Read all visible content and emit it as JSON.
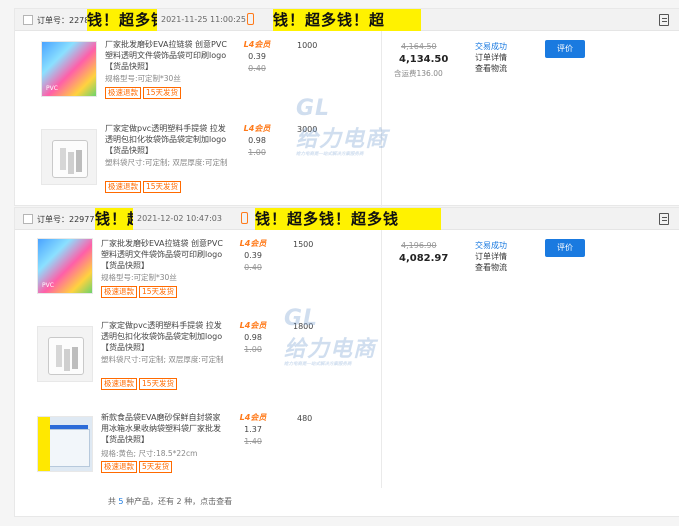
{
  "orders": [
    {
      "order_no": "订单号：2278072",
      "date": "2021-11-25 11:00:25",
      "overlay_text": "钱！超多钱！超",
      "items": [
        {
          "title": "厂家批发磨砂EVA拉链袋 创意PVC塑料透明文件袋饰品袋可印刷logo 【货品快照】",
          "spec": "规格型号:可定制*30丝",
          "tags": [
            "极速退款",
            "15天发货"
          ],
          "level": "L4会员",
          "price": "0.39",
          "orig_price": "0.40",
          "qty": "1000",
          "thumb": "colorful-bags"
        },
        {
          "title": "厂家定做pvc透明塑料手提袋 拉发透明包扣化妆袋饰品袋定制加logo 【货品快照】",
          "spec": "塑料袋尺寸:可定制; 双层厚度:可定制",
          "tags": [
            "极速退款",
            "15天发货"
          ],
          "level": "L4会员",
          "price": "0.98",
          "orig_price": "1.00",
          "qty": "3000",
          "thumb": "clear-bag"
        }
      ],
      "total_orig": "4,164.50",
      "total": "4,134.50",
      "shipping": "含运费136.00",
      "status": [
        "交易成功",
        "订单详情",
        "查看物流"
      ],
      "action": "评价"
    },
    {
      "order_no": "订单号：229770",
      "date": "2021-12-02 10:47:03",
      "overlay_text": "钱！超多钱！超多钱",
      "items": [
        {
          "title": "厂家批发磨砂EVA拉链袋 创意PVC塑料透明文件袋饰品袋可印刷logo 【货品快照】",
          "spec": "规格型号:可定制*30丝",
          "tags": [
            "极速退款",
            "15天发货"
          ],
          "level": "L4会员",
          "price": "0.39",
          "orig_price": "0.40",
          "qty": "1500",
          "thumb": "colorful-bags"
        },
        {
          "title": "厂家定做pvc透明塑料手提袋 拉发透明包扣化妆袋饰品袋定制加logo 【货品快照】",
          "spec": "塑料袋尺寸:可定制; 双层厚度:可定制",
          "tags": [
            "极速退款",
            "15天发货"
          ],
          "level": "L4会员",
          "price": "0.98",
          "orig_price": "1.00",
          "qty": "1800",
          "thumb": "clear-bag"
        },
        {
          "title": "新款食品袋EVA磨砂保鲜自封袋家用冰箱水果收纳袋塑料袋厂家批发 【货品快照】",
          "spec": "规格:黄色; 尺寸:18.5*22cm",
          "tags": [
            "极速退款",
            "5天发货"
          ],
          "level": "L4会员",
          "price": "1.37",
          "orig_price": "1.40",
          "qty": "480",
          "thumb": "zip-bag"
        }
      ],
      "total_orig": "4,196.90",
      "total": "4,082.97",
      "status": [
        "交易成功",
        "订单详情",
        "查看物流"
      ],
      "action": "评价"
    }
  ],
  "watermark": {
    "logo": "GL",
    "name": "给力电商",
    "slogan": "给力电商是一站式解决方案服务商"
  },
  "footer": {
    "prefix": "共",
    "count": "5",
    "mid": "种产品，还有",
    "more": "2",
    "suffix": "种，点击查看"
  }
}
